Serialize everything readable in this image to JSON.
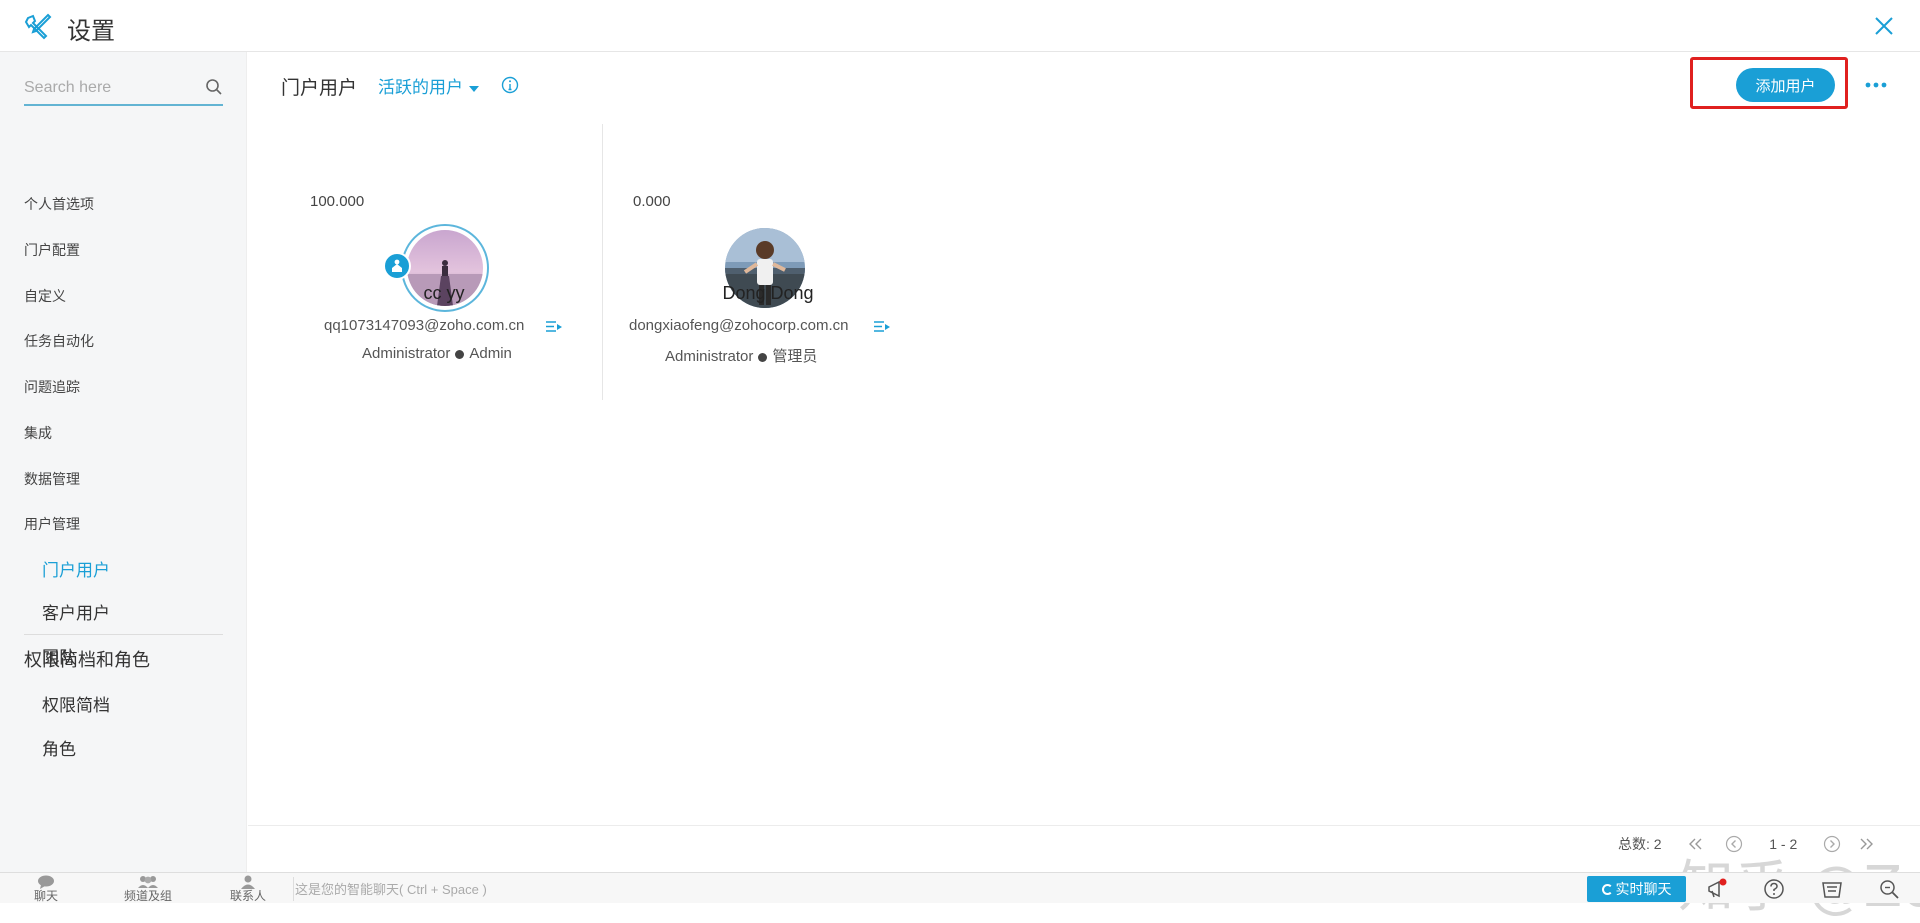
{
  "header": {
    "title": "设置"
  },
  "sidebar": {
    "search_placeholder": "Search here",
    "items": [
      "个人首选项",
      "门户配置",
      "自定义",
      "任务自动化",
      "问题追踪",
      "集成",
      "数据管理",
      "用户管理"
    ],
    "user_mgmt_subitems": [
      "门户用户",
      "客户用户",
      "团队"
    ],
    "section_title": "权限简档和角色",
    "section_subitems": [
      "权限简档",
      "角色"
    ]
  },
  "main": {
    "title": "门户用户",
    "filter_label": "活跃的用户",
    "add_user_label": "添加用户",
    "users": [
      {
        "score": "100.000",
        "name": "cc yy",
        "email": "qq1073147093@zoho.com.cn",
        "role": "Administrator",
        "profile": "Admin"
      },
      {
        "score": "0.000",
        "name": "Dong Dong",
        "email": "dongxiaofeng@zohocorp.com.cn",
        "role": "Administrator",
        "profile": "管理员"
      }
    ],
    "pager": {
      "total_label": "总数: 2",
      "range": "1 - 2"
    }
  },
  "watermark": "知乎 @Zoho Mail",
  "bottombar": {
    "items": [
      "聊天",
      "频道及组",
      "联系人"
    ],
    "chat_placeholder": "这是您的智能聊天( Ctrl + Space )",
    "live_chat_label": "实时聊天"
  },
  "colors": {
    "accent": "#1a9fd6",
    "highlight": "#e0201f"
  }
}
